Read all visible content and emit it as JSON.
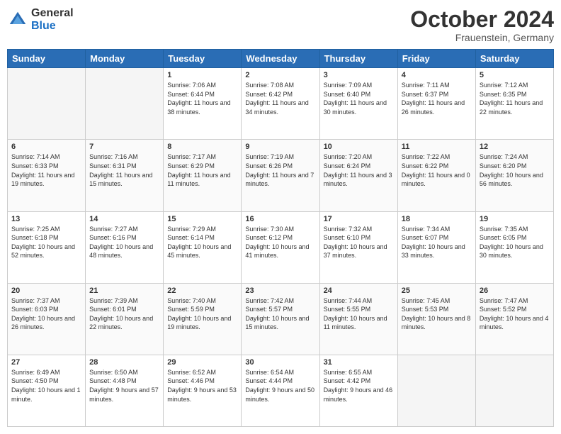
{
  "header": {
    "logo": {
      "general": "General",
      "blue": "Blue"
    },
    "title": "October 2024",
    "location": "Frauenstein, Germany"
  },
  "weekdays": [
    "Sunday",
    "Monday",
    "Tuesday",
    "Wednesday",
    "Thursday",
    "Friday",
    "Saturday"
  ],
  "weeks": [
    [
      {
        "day": "",
        "empty": true
      },
      {
        "day": "",
        "empty": true
      },
      {
        "day": "1",
        "sunrise": "Sunrise: 7:06 AM",
        "sunset": "Sunset: 6:44 PM",
        "daylight": "Daylight: 11 hours and 38 minutes."
      },
      {
        "day": "2",
        "sunrise": "Sunrise: 7:08 AM",
        "sunset": "Sunset: 6:42 PM",
        "daylight": "Daylight: 11 hours and 34 minutes."
      },
      {
        "day": "3",
        "sunrise": "Sunrise: 7:09 AM",
        "sunset": "Sunset: 6:40 PM",
        "daylight": "Daylight: 11 hours and 30 minutes."
      },
      {
        "day": "4",
        "sunrise": "Sunrise: 7:11 AM",
        "sunset": "Sunset: 6:37 PM",
        "daylight": "Daylight: 11 hours and 26 minutes."
      },
      {
        "day": "5",
        "sunrise": "Sunrise: 7:12 AM",
        "sunset": "Sunset: 6:35 PM",
        "daylight": "Daylight: 11 hours and 22 minutes."
      }
    ],
    [
      {
        "day": "6",
        "sunrise": "Sunrise: 7:14 AM",
        "sunset": "Sunset: 6:33 PM",
        "daylight": "Daylight: 11 hours and 19 minutes."
      },
      {
        "day": "7",
        "sunrise": "Sunrise: 7:16 AM",
        "sunset": "Sunset: 6:31 PM",
        "daylight": "Daylight: 11 hours and 15 minutes."
      },
      {
        "day": "8",
        "sunrise": "Sunrise: 7:17 AM",
        "sunset": "Sunset: 6:29 PM",
        "daylight": "Daylight: 11 hours and 11 minutes."
      },
      {
        "day": "9",
        "sunrise": "Sunrise: 7:19 AM",
        "sunset": "Sunset: 6:26 PM",
        "daylight": "Daylight: 11 hours and 7 minutes."
      },
      {
        "day": "10",
        "sunrise": "Sunrise: 7:20 AM",
        "sunset": "Sunset: 6:24 PM",
        "daylight": "Daylight: 11 hours and 3 minutes."
      },
      {
        "day": "11",
        "sunrise": "Sunrise: 7:22 AM",
        "sunset": "Sunset: 6:22 PM",
        "daylight": "Daylight: 11 hours and 0 minutes."
      },
      {
        "day": "12",
        "sunrise": "Sunrise: 7:24 AM",
        "sunset": "Sunset: 6:20 PM",
        "daylight": "Daylight: 10 hours and 56 minutes."
      }
    ],
    [
      {
        "day": "13",
        "sunrise": "Sunrise: 7:25 AM",
        "sunset": "Sunset: 6:18 PM",
        "daylight": "Daylight: 10 hours and 52 minutes."
      },
      {
        "day": "14",
        "sunrise": "Sunrise: 7:27 AM",
        "sunset": "Sunset: 6:16 PM",
        "daylight": "Daylight: 10 hours and 48 minutes."
      },
      {
        "day": "15",
        "sunrise": "Sunrise: 7:29 AM",
        "sunset": "Sunset: 6:14 PM",
        "daylight": "Daylight: 10 hours and 45 minutes."
      },
      {
        "day": "16",
        "sunrise": "Sunrise: 7:30 AM",
        "sunset": "Sunset: 6:12 PM",
        "daylight": "Daylight: 10 hours and 41 minutes."
      },
      {
        "day": "17",
        "sunrise": "Sunrise: 7:32 AM",
        "sunset": "Sunset: 6:10 PM",
        "daylight": "Daylight: 10 hours and 37 minutes."
      },
      {
        "day": "18",
        "sunrise": "Sunrise: 7:34 AM",
        "sunset": "Sunset: 6:07 PM",
        "daylight": "Daylight: 10 hours and 33 minutes."
      },
      {
        "day": "19",
        "sunrise": "Sunrise: 7:35 AM",
        "sunset": "Sunset: 6:05 PM",
        "daylight": "Daylight: 10 hours and 30 minutes."
      }
    ],
    [
      {
        "day": "20",
        "sunrise": "Sunrise: 7:37 AM",
        "sunset": "Sunset: 6:03 PM",
        "daylight": "Daylight: 10 hours and 26 minutes."
      },
      {
        "day": "21",
        "sunrise": "Sunrise: 7:39 AM",
        "sunset": "Sunset: 6:01 PM",
        "daylight": "Daylight: 10 hours and 22 minutes."
      },
      {
        "day": "22",
        "sunrise": "Sunrise: 7:40 AM",
        "sunset": "Sunset: 5:59 PM",
        "daylight": "Daylight: 10 hours and 19 minutes."
      },
      {
        "day": "23",
        "sunrise": "Sunrise: 7:42 AM",
        "sunset": "Sunset: 5:57 PM",
        "daylight": "Daylight: 10 hours and 15 minutes."
      },
      {
        "day": "24",
        "sunrise": "Sunrise: 7:44 AM",
        "sunset": "Sunset: 5:55 PM",
        "daylight": "Daylight: 10 hours and 11 minutes."
      },
      {
        "day": "25",
        "sunrise": "Sunrise: 7:45 AM",
        "sunset": "Sunset: 5:53 PM",
        "daylight": "Daylight: 10 hours and 8 minutes."
      },
      {
        "day": "26",
        "sunrise": "Sunrise: 7:47 AM",
        "sunset": "Sunset: 5:52 PM",
        "daylight": "Daylight: 10 hours and 4 minutes."
      }
    ],
    [
      {
        "day": "27",
        "sunrise": "Sunrise: 6:49 AM",
        "sunset": "Sunset: 4:50 PM",
        "daylight": "Daylight: 10 hours and 1 minute."
      },
      {
        "day": "28",
        "sunrise": "Sunrise: 6:50 AM",
        "sunset": "Sunset: 4:48 PM",
        "daylight": "Daylight: 9 hours and 57 minutes."
      },
      {
        "day": "29",
        "sunrise": "Sunrise: 6:52 AM",
        "sunset": "Sunset: 4:46 PM",
        "daylight": "Daylight: 9 hours and 53 minutes."
      },
      {
        "day": "30",
        "sunrise": "Sunrise: 6:54 AM",
        "sunset": "Sunset: 4:44 PM",
        "daylight": "Daylight: 9 hours and 50 minutes."
      },
      {
        "day": "31",
        "sunrise": "Sunrise: 6:55 AM",
        "sunset": "Sunset: 4:42 PM",
        "daylight": "Daylight: 9 hours and 46 minutes."
      },
      {
        "day": "",
        "empty": true
      },
      {
        "day": "",
        "empty": true
      }
    ]
  ]
}
